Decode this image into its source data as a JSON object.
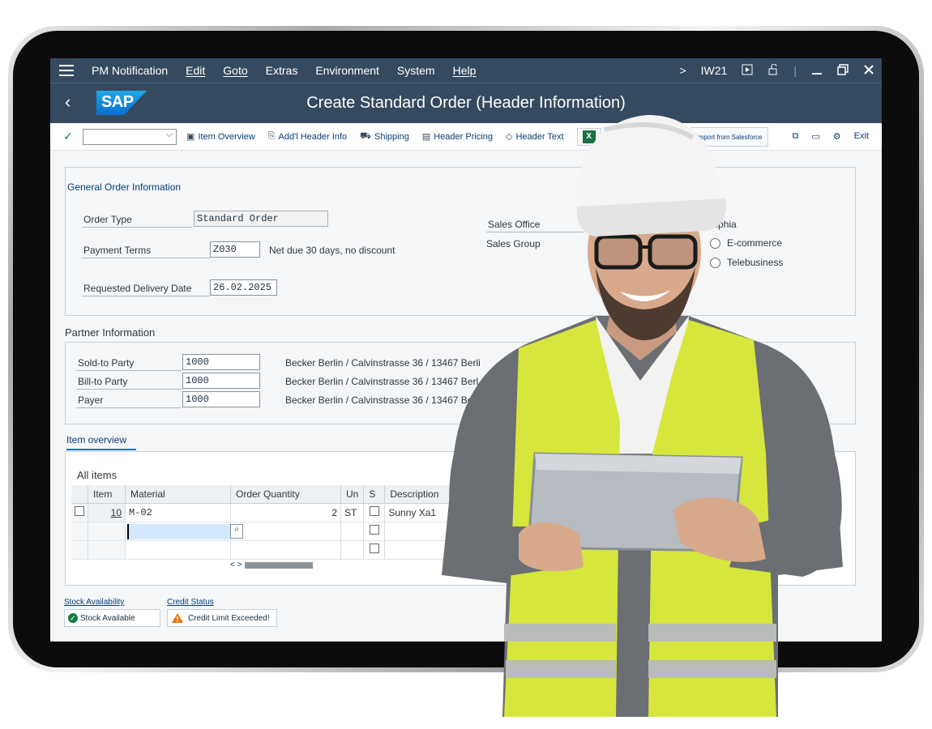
{
  "menu": {
    "items": [
      "PM Notification",
      "Edit",
      "Goto",
      "Extras",
      "Environment",
      "System",
      "Help"
    ],
    "right": {
      "chevron": ">",
      "tcode": "IW21"
    }
  },
  "title": "Create Standard Order (Header Information)",
  "logo_text": "SAP",
  "toolbar": {
    "item_overview": "Item Overview",
    "addl_header": "Add'l Header Info",
    "shipping": "Shipping",
    "header_pricing": "Header Pricing",
    "header_text": "Header Text",
    "salesforce": "Import from Salesforce",
    "exit": "Exit"
  },
  "general": {
    "title": "General Order Information",
    "order_type_label": "Order Type",
    "order_type_value": "Standard Order",
    "payment_terms_label": "Payment Terms",
    "payment_terms_value": "Z030",
    "payment_terms_text": "Net due 30 days, no discount",
    "delivery_date_label": "Requested Delivery Date",
    "delivery_date_value": "26.02.2025",
    "sales_office_label": "Sales Office",
    "sales_group_label": "Sales Group",
    "sales_office_value_partial": "delphia",
    "radio1": "E-commerce",
    "radio2": "Telebusiness"
  },
  "partner": {
    "title": "Partner Information",
    "rows": [
      {
        "label": "Sold-to Party",
        "value": "1000",
        "desc": "Becker Berlin / Calvinstrasse 36 / 13467 Berli"
      },
      {
        "label": "Bill-to Party",
        "value": "1000",
        "desc": "Becker Berlin / Calvinstrasse 36 / 13467 Berl"
      },
      {
        "label": "Payer",
        "value": "1000",
        "desc": "Becker Berlin / Calvinstrasse 36 / 13467 Be"
      }
    ]
  },
  "items": {
    "tab": "Item overview",
    "title": "All items",
    "headers": [
      "Item",
      "Material",
      "Order Quantity",
      "Un",
      "S",
      "Description"
    ],
    "row1": {
      "item": "10",
      "material": "M-02",
      "qty": "2",
      "unit": "ST",
      "desc": "Sunny Xa1"
    },
    "scroll": "< >"
  },
  "status": {
    "stock_label": "Stock Availability",
    "stock_value": "Stock Available",
    "credit_label": "Credit Status",
    "credit_value": "Credit Limit Exceeded!"
  },
  "colors": {
    "shell": "#354a5f",
    "accent": "#0a6ed1",
    "vest": "#d7e83a",
    "success": "#107e3e",
    "warning": "#e9730c"
  }
}
